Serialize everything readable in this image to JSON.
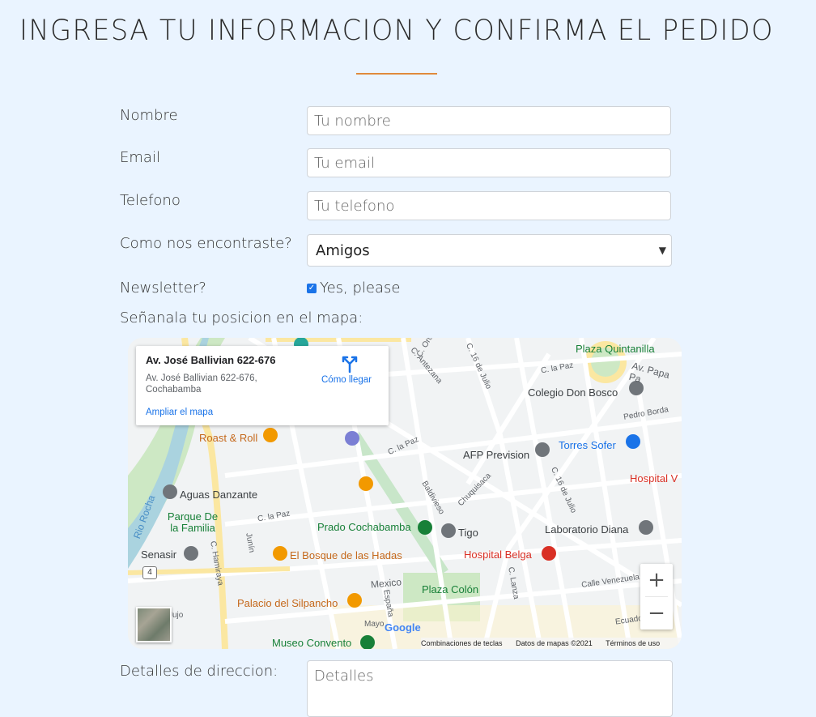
{
  "page": {
    "title": "INGRESA TU INFORMACION Y CONFIRMA EL PEDIDO",
    "accent_color": "#e08a3c"
  },
  "form": {
    "name_label": "Nombre",
    "name_placeholder": "Tu nombre",
    "email_label": "Email",
    "email_placeholder": "Tu email",
    "phone_label": "Telefono",
    "phone_placeholder": "Tu telefono",
    "source_label": "Como nos encontraste?",
    "source_value": "Amigos",
    "newsletter_label": "Newsletter?",
    "newsletter_checked": true,
    "newsletter_option": "Yes, please",
    "map_label": "Señanala tu posicion en el mapa:",
    "details_label": "Detalles de direccion:",
    "details_placeholder": "Detalles"
  },
  "map": {
    "card_title": "Av. José Ballivian 622-676",
    "card_address": "Av. José Ballivian 622-676, Cochabamba",
    "directions_label": "Cómo llegar",
    "enlarge_label": "Ampliar el mapa",
    "zoom_in": "+",
    "zoom_out": "−",
    "google": "Google",
    "attribution": {
      "shortcuts": "Combinaciones de teclas",
      "data": "Datos de mapas ©2021",
      "terms": "Términos de uso"
    },
    "places": [
      {
        "name": "Plaza Quintanilla",
        "line2": "",
        "color": "#188038"
      },
      {
        "name": "Colegio Don Bosco",
        "color": "#3c4043"
      },
      {
        "name": "Roast & Roll",
        "color": "#c5691c"
      },
      {
        "name": "AFP Prevision",
        "color": "#3c4043"
      },
      {
        "name": "Torres Sofer",
        "color": "#1a73e8"
      },
      {
        "name": "Hospital V",
        "color": "#d93025"
      },
      {
        "name": "Aguas Danzante",
        "color": "#3c4043"
      },
      {
        "name": "Parque De la Familia",
        "color": "#188038"
      },
      {
        "name": "Prado Cochabamba",
        "color": "#188038"
      },
      {
        "name": "Tigo",
        "color": "#3c4043"
      },
      {
        "name": "Laboratorio Diana",
        "color": "#3c4043"
      },
      {
        "name": "Senasir",
        "color": "#3c4043"
      },
      {
        "name": "El Bosque de las Hadas",
        "color": "#c5691c"
      },
      {
        "name": "Hospital Belga",
        "color": "#d93025"
      },
      {
        "name": "Plaza Colón",
        "color": "#188038"
      },
      {
        "name": "Palacio del Silpancho",
        "color": "#c5691c"
      },
      {
        "name": "Museo Convento",
        "color": "#188038"
      }
    ],
    "streets": [
      "C. Oruro",
      "C. 16 de Julio",
      "C. Antezana",
      "C. la Paz",
      "Av. Papa Pa",
      "Pedro Borda",
      "Baldivieso",
      "Chuquisaca",
      "C. 16 de Julio",
      "C. la Paz",
      "Junín",
      "C. Hamiraya",
      "Rio Rocha",
      "Mexico",
      "España",
      "C. Lanza",
      "Calle Venezuela",
      "Ecuador",
      "4",
      "Mayo",
      "Jujo"
    ]
  }
}
